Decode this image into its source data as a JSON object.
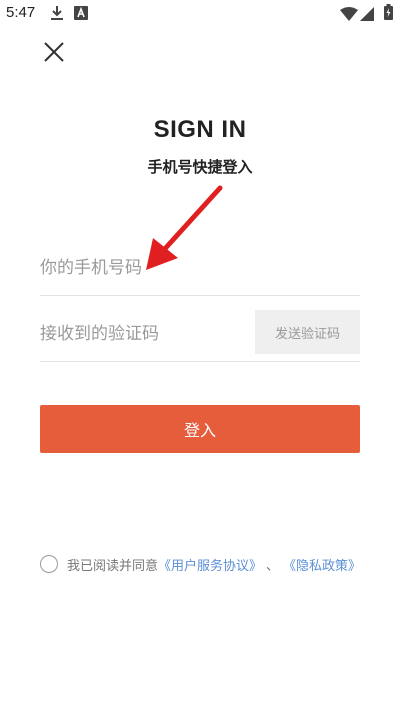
{
  "status_bar": {
    "time": "5:47",
    "icons": [
      "download-icon",
      "a-notification-icon",
      "wifi-icon",
      "signal-icon",
      "battery-charging-icon"
    ]
  },
  "header": {
    "close_icon": "close-icon"
  },
  "login": {
    "title": "SIGN IN",
    "subtitle": "手机号快捷登入",
    "phone_placeholder": "你的手机号码",
    "code_placeholder": "接收到的验证码",
    "send_code_label": "发送验证码",
    "submit_label": "登入"
  },
  "agreement": {
    "prefix": "我已阅读并同意",
    "user_agreement": "《用户服务协议》",
    "separator": "、",
    "privacy_policy": "《隐私政策》"
  },
  "colors": {
    "accent": "#e65d3c",
    "link": "#5b8fd6",
    "annotation_arrow": "#e02020"
  }
}
